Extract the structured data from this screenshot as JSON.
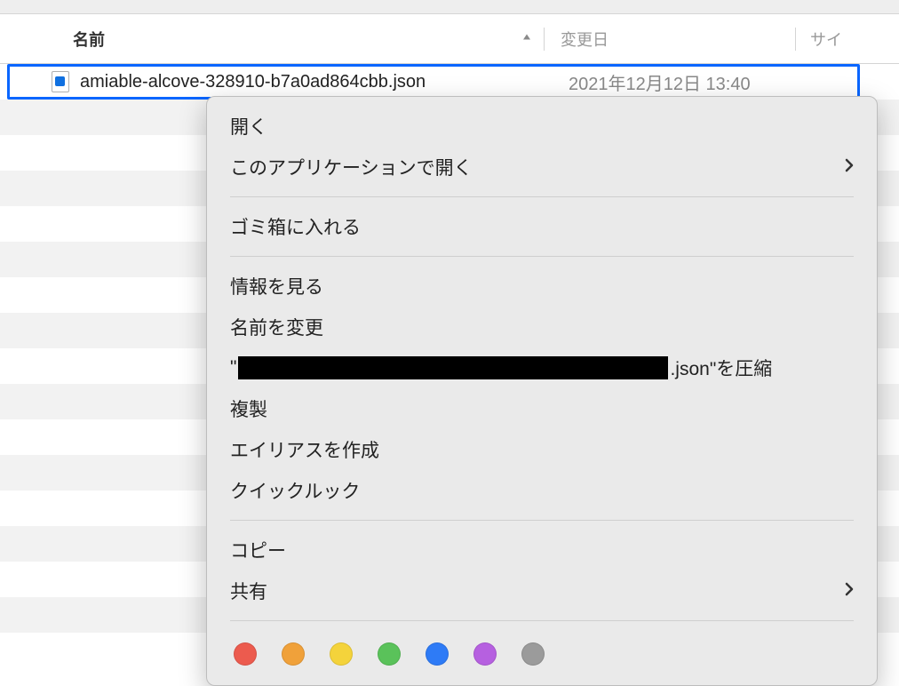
{
  "header": {
    "name_label": "名前",
    "modified_label": "変更日",
    "size_label": "サイ"
  },
  "file": {
    "name": "amiable-alcove-328910-b7a0ad864cbb.json",
    "modified": "2021年12月12日 13:40"
  },
  "menu": {
    "open": "開く",
    "open_with": "このアプリケーションで開く",
    "trash": "ゴミ箱に入れる",
    "get_info": "情報を見る",
    "rename": "名前を変更",
    "compress_prefix": "\"",
    "compress_suffix": ".json\"を圧縮",
    "duplicate": "複製",
    "make_alias": "エイリアスを作成",
    "quick_look": "クイックルック",
    "copy": "コピー",
    "share": "共有"
  },
  "tags": {
    "colors": [
      "#ec5b4e",
      "#f0a13a",
      "#f4d33b",
      "#5ac25a",
      "#2e7bf6",
      "#b660e0",
      "#9b9b9b"
    ]
  }
}
